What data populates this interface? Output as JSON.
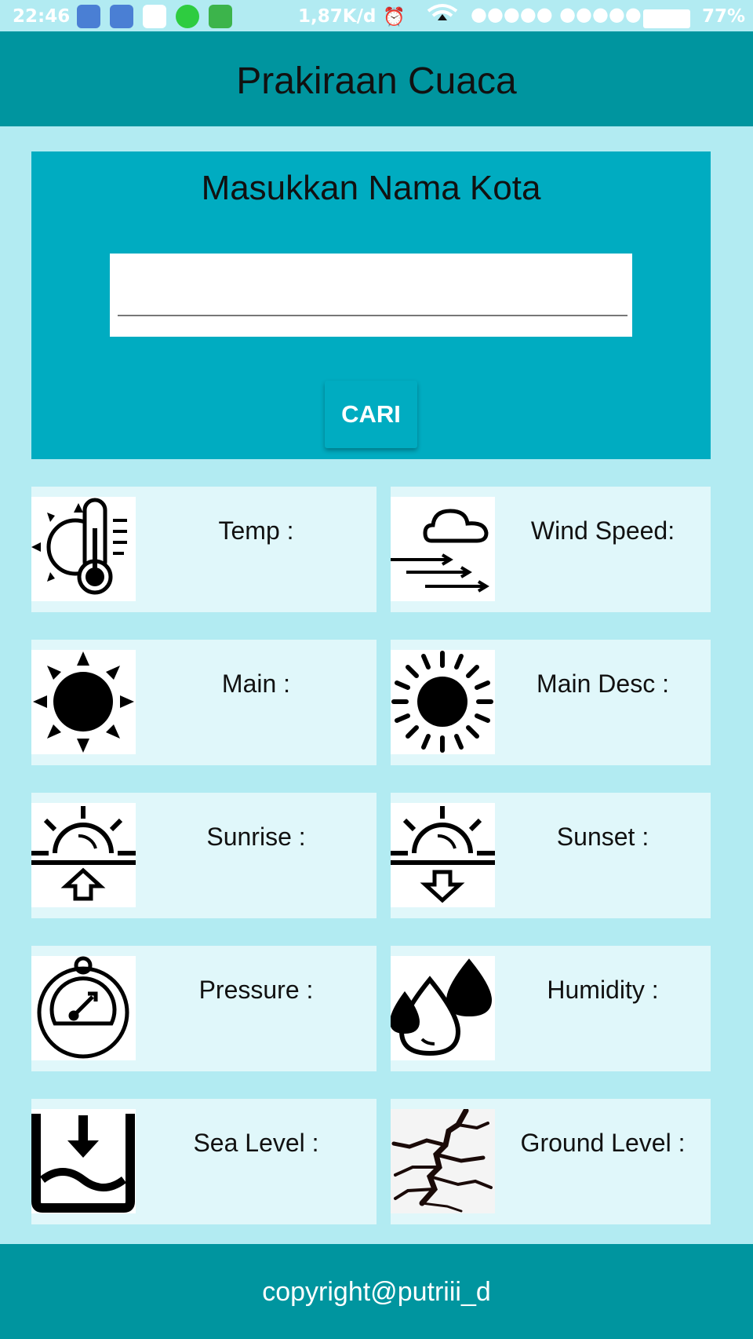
{
  "status": {
    "time": "22:46",
    "speed": "1,87K/d",
    "signal": "●●●●● ●●●●●",
    "battery": "77%"
  },
  "app": {
    "title": "Prakiraan Cuaca"
  },
  "search": {
    "prompt": "Masukkan Nama Kota",
    "value": "",
    "placeholder": "",
    "button": "CARI"
  },
  "cards": {
    "temp": "Temp :",
    "wind": "Wind Speed:",
    "main": "Main :",
    "main_desc": "Main Desc :",
    "sunrise": "Sunrise :",
    "sunset": "Sunset :",
    "pressure": "Pressure :",
    "humidity": "Humidity :",
    "sea_level": "Sea Level :",
    "ground_level": "Ground Level :"
  },
  "footer": {
    "copyright": "copyright@putriii_d"
  },
  "colors": {
    "appbar": "#00959f",
    "search_card": "#00acc1",
    "card": "#e0f7fa",
    "background": "#b2ebf2"
  }
}
